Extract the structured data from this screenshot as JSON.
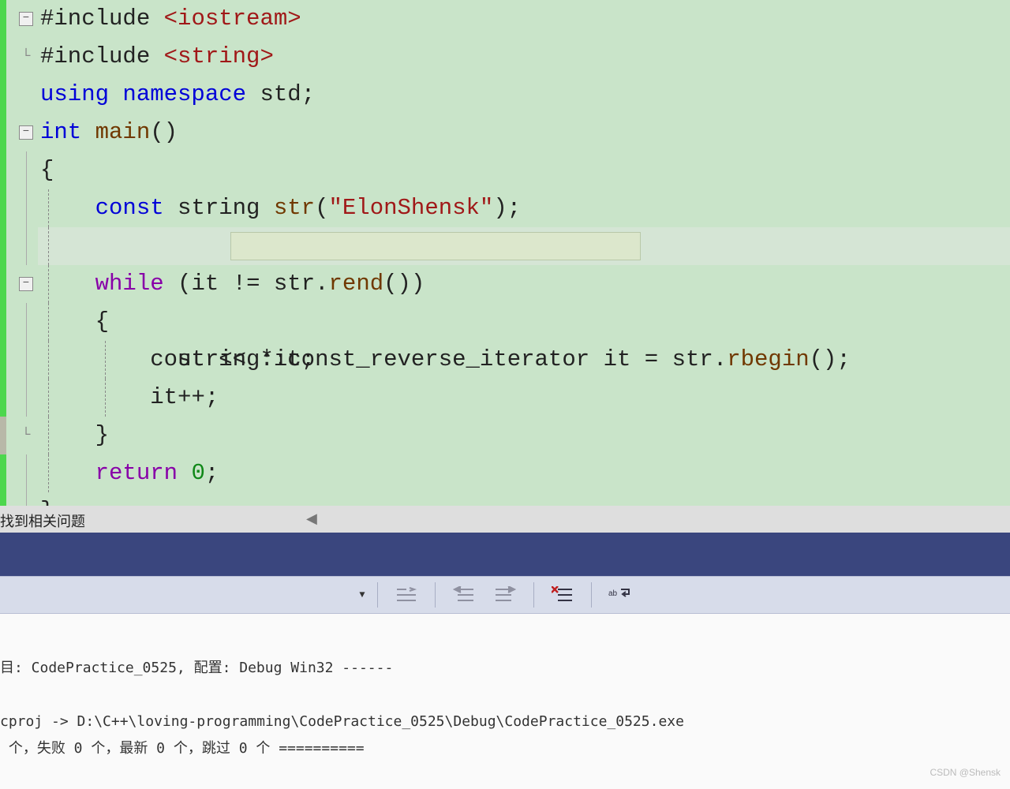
{
  "code": {
    "include1_a": "#include ",
    "include1_b": "<iostream>",
    "include2_a": "#include ",
    "include2_b": "<string>",
    "using_a": "using",
    "using_b": "namespace",
    "using_c": "std",
    "main_a": "int",
    "main_b": "main",
    "brace_open": "{",
    "const": "const",
    "string_t": "string",
    "str_var": "str",
    "str_lit": "\"ElonShensk\"",
    "it_line_a": "string",
    "it_line_b": "const_reverse_iterator",
    "it_line_c": "it",
    "it_line_d": "str",
    "it_line_e": "rbegin",
    "while": "while",
    "while_it": "it",
    "while_str": "str",
    "while_rend": "rend",
    "inner_open": "{",
    "cout": "cout",
    "deref_it": "it",
    "incr": "it",
    "inner_close": "}",
    "return": "return",
    "zero": "0",
    "brace_close": "}"
  },
  "fold": {
    "minus": "−"
  },
  "problems_text": "找到相关问题",
  "output": {
    "line1": "目: CodePractice_0525, 配置: Debug Win32 ------",
    "line2": "cproj -> D:\\C++\\loving-programming\\CodePractice_0525\\Debug\\CodePractice_0525.exe",
    "line3": " 个，失败 0 个，最新 0 个，跳过 0 个 =========="
  },
  "watermark": "CSDN @Shensk"
}
